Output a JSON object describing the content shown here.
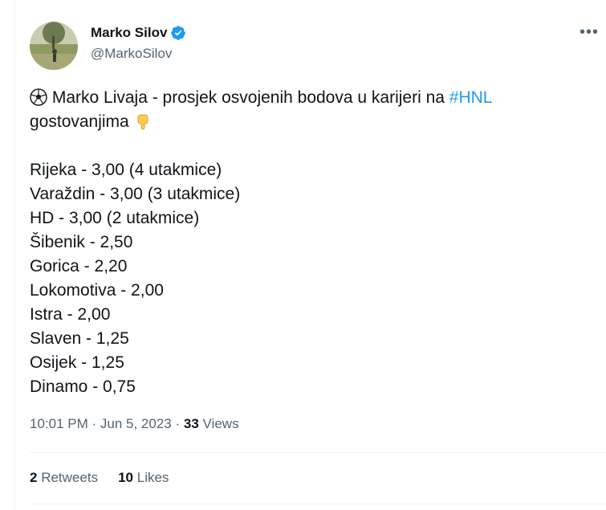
{
  "author": {
    "name": "Marko Silov",
    "handle": "@MarkoSilov",
    "verified": true
  },
  "tweet": {
    "headline": "Marko Livaja - prosjek osvojenih bodova u karijeri na ",
    "hashtag": "#HNL",
    "headline_cont": "gostovanjima",
    "lines": [
      "Rijeka - 3,00 (4 utakmice)",
      "Varaždin - 3,00 (3 utakmice)",
      "HD - 3,00 (2 utakmice)",
      "Šibenik - 2,50",
      "Gorica - 2,20",
      "Lokomotiva - 2,00",
      "Istra - 2,00",
      "Slaven - 1,25",
      "Osijek - 1,25",
      "Dinamo - 0,75"
    ]
  },
  "meta": {
    "time": "10:01 PM",
    "date": "Jun 5, 2023",
    "views_count": "33",
    "views_label": "Views"
  },
  "stats": {
    "retweets_count": "2",
    "retweets_label": "Retweets",
    "likes_count": "10",
    "likes_label": "Likes"
  },
  "icons": [
    "avatar-photo",
    "verified-badge-icon",
    "more-options-icon",
    "soccer-ball-icon",
    "pointing-down-icon"
  ],
  "colors": {
    "accent": "#1d9bf0",
    "text": "#0f1419",
    "secondary": "#536471"
  }
}
